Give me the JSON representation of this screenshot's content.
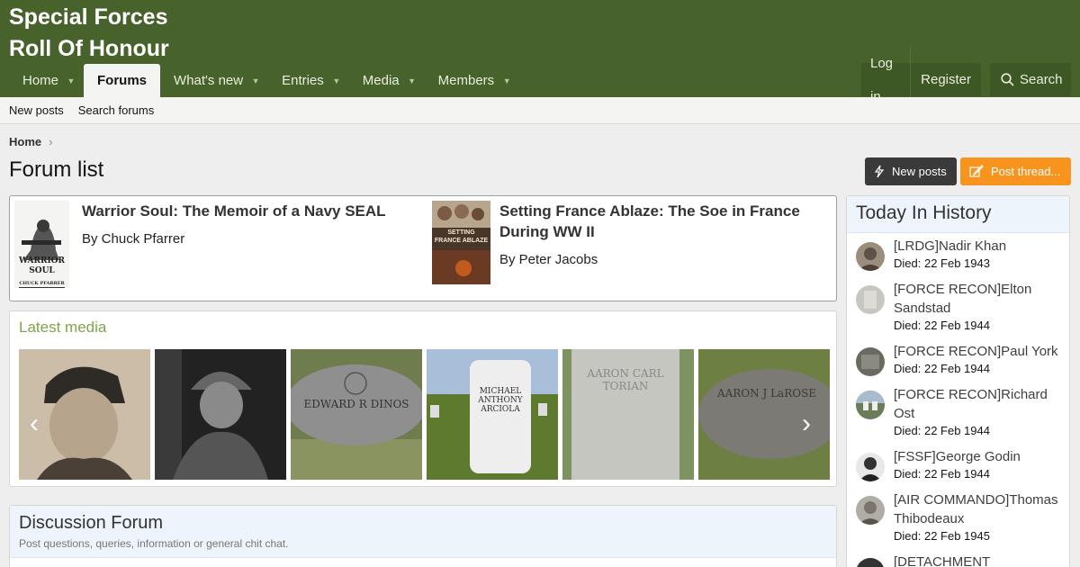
{
  "header": {
    "logo_line1": "Special Forces",
    "logo_line2": "Roll Of Honour",
    "nav": [
      {
        "label": "Home"
      },
      {
        "label": "Forums"
      },
      {
        "label": "What's new"
      },
      {
        "label": "Entries"
      },
      {
        "label": "Media"
      },
      {
        "label": "Members"
      }
    ],
    "login": "Log in",
    "register": "Register",
    "search": "Search"
  },
  "subnav": {
    "new_posts": "New posts",
    "search_forums": "Search forums"
  },
  "breadcrumb": {
    "home": "Home"
  },
  "page": {
    "title": "Forum list",
    "new_posts_button": "New posts",
    "post_thread_button": "Post thread..."
  },
  "featured": [
    {
      "title": "Warrior Soul: The Memoir of a Navy SEAL",
      "author": "By Chuck Pfarrer",
      "cover_line1": "WARRIOR",
      "cover_line2": "SOUL",
      "cover_author": "CHUCK PFARRER"
    },
    {
      "title_line1": "Setting France Ablaze: The Soe in France",
      "title_line2": "During WW II",
      "author": "By Peter Jacobs",
      "cover_line1": "SETTING",
      "cover_line2": "FRANCE ABLAZE"
    }
  ],
  "media": {
    "title": "Latest media",
    "items": [
      {
        "alt": "portrait-photo"
      },
      {
        "alt": "soldier-photo"
      },
      {
        "text": "EDWARD R DINOS"
      },
      {
        "text": "MICHAEL ANTHONY ARCIOLA"
      },
      {
        "text": "AARON CARL TORIAN"
      },
      {
        "text": "AARON J LaROSE"
      }
    ]
  },
  "discussion": {
    "title": "Discussion Forum",
    "description": "Post questions, queries, information or general chit chat."
  },
  "history": {
    "title": "Today In History",
    "items": [
      {
        "name": "[LRDG]Nadir Khan",
        "died": "Died: 22 Feb 1943"
      },
      {
        "name": "[FORCE RECON]Elton Sandstad",
        "died": "Died: 22 Feb 1944"
      },
      {
        "name": "[FORCE RECON]Paul York",
        "died": "Died: 22 Feb 1944"
      },
      {
        "name": "[FORCE RECON]Richard Ost",
        "died": "Died: 22 Feb 1944"
      },
      {
        "name": "[FSSF]George Godin",
        "died": "Died: 22 Feb 1944"
      },
      {
        "name": "[AIR COMMANDO]Thomas Thibodeaux",
        "died": "Died: 22 Feb 1945"
      },
      {
        "name": "[DETACHMENT"
      }
    ]
  },
  "colors": {
    "header_bg": "#47632b",
    "accent_orange": "#f7941d",
    "dark_button": "#3a3a3a",
    "media_title": "#7aa84a"
  }
}
